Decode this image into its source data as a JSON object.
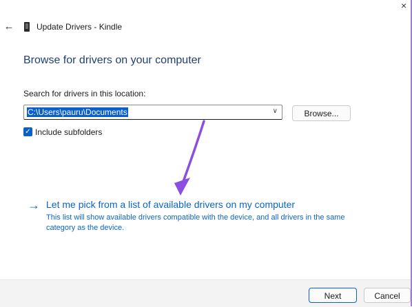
{
  "window": {
    "title": "Update Drivers - Kindle",
    "close_glyph": "×"
  },
  "header": {
    "back_icon": "back-arrow-icon",
    "device_icon": "kindle-device-icon"
  },
  "main": {
    "heading": "Browse for drivers on your computer",
    "search_label": "Search for drivers in this location:",
    "path_value": "C:\\Users\\pauru\\Documents",
    "browse_label": "Browse...",
    "include_subfolders_label": "Include subfolders",
    "include_subfolders_checked": true,
    "pick_title": "Let me pick from a list of available drivers on my computer",
    "pick_desc": "This list will show available drivers compatible with the device, and all drivers in the same category as the device."
  },
  "footer": {
    "next_label": "Next",
    "cancel_label": "Cancel"
  },
  "colors": {
    "accent": "#0a5fc9",
    "link": "#0a64c8",
    "heading": "#1f3f73",
    "annotation": "#8a4fe0"
  }
}
